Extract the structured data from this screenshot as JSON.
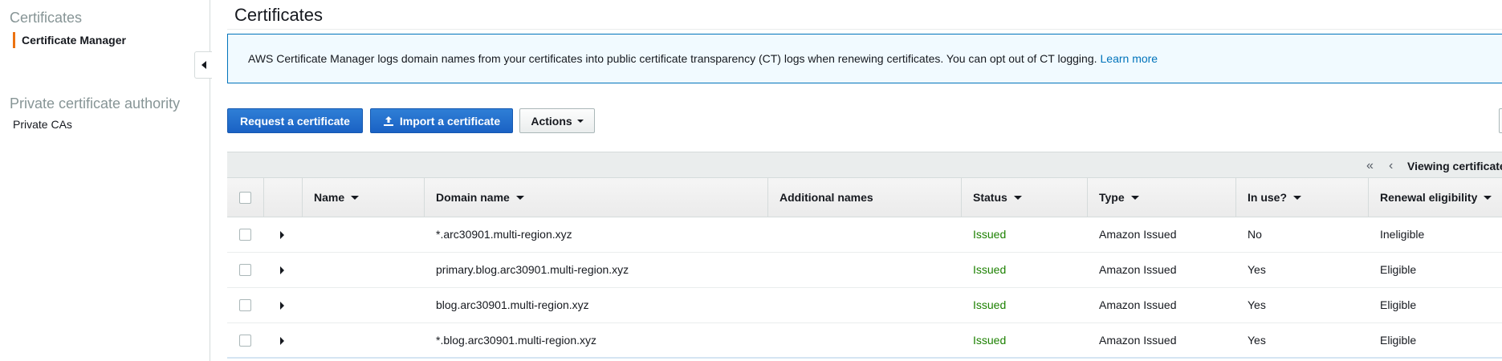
{
  "sidebar": {
    "sections": [
      {
        "title": "Certificates",
        "items": [
          {
            "label": "Certificate Manager",
            "active": true
          }
        ]
      },
      {
        "title": "Private certificate authority",
        "items": [
          {
            "label": "Private CAs",
            "active": false
          }
        ]
      }
    ]
  },
  "page": {
    "title": "Certificates"
  },
  "banner": {
    "text": "AWS Certificate Manager logs domain names from your certificates into public certificate transparency (CT) logs when renewing certificates. You can opt out of CT logging.",
    "link": "Learn more"
  },
  "toolbar": {
    "request_label": "Request a certificate",
    "import_label": "Import a certificate",
    "actions_label": "Actions"
  },
  "pager": {
    "first_icon": "double-chevron-left-icon",
    "prev_icon": "chevron-left-icon",
    "text": "Viewing certificate"
  },
  "table": {
    "columns": [
      "Name",
      "Domain name",
      "Additional names",
      "Status",
      "Type",
      "In use?",
      "Renewal eligibility"
    ],
    "rows": [
      {
        "name": "",
        "domain": "*.arc30901.multi-region.xyz",
        "additional": "",
        "status": "Issued",
        "type": "Amazon Issued",
        "in_use": "No",
        "renewal": "Ineligible"
      },
      {
        "name": "",
        "domain": "primary.blog.arc30901.multi-region.xyz",
        "additional": "",
        "status": "Issued",
        "type": "Amazon Issued",
        "in_use": "Yes",
        "renewal": "Eligible"
      },
      {
        "name": "",
        "domain": "blog.arc30901.multi-region.xyz",
        "additional": "",
        "status": "Issued",
        "type": "Amazon Issued",
        "in_use": "Yes",
        "renewal": "Eligible"
      },
      {
        "name": "",
        "domain": "*.blog.arc30901.multi-region.xyz",
        "additional": "",
        "status": "Issued",
        "type": "Amazon Issued",
        "in_use": "Yes",
        "renewal": "Eligible"
      }
    ]
  },
  "colors": {
    "primary_button": "#1a62c4",
    "link": "#0073bb",
    "status_issued": "#1d8102",
    "active_nav_accent": "#ec7211"
  }
}
